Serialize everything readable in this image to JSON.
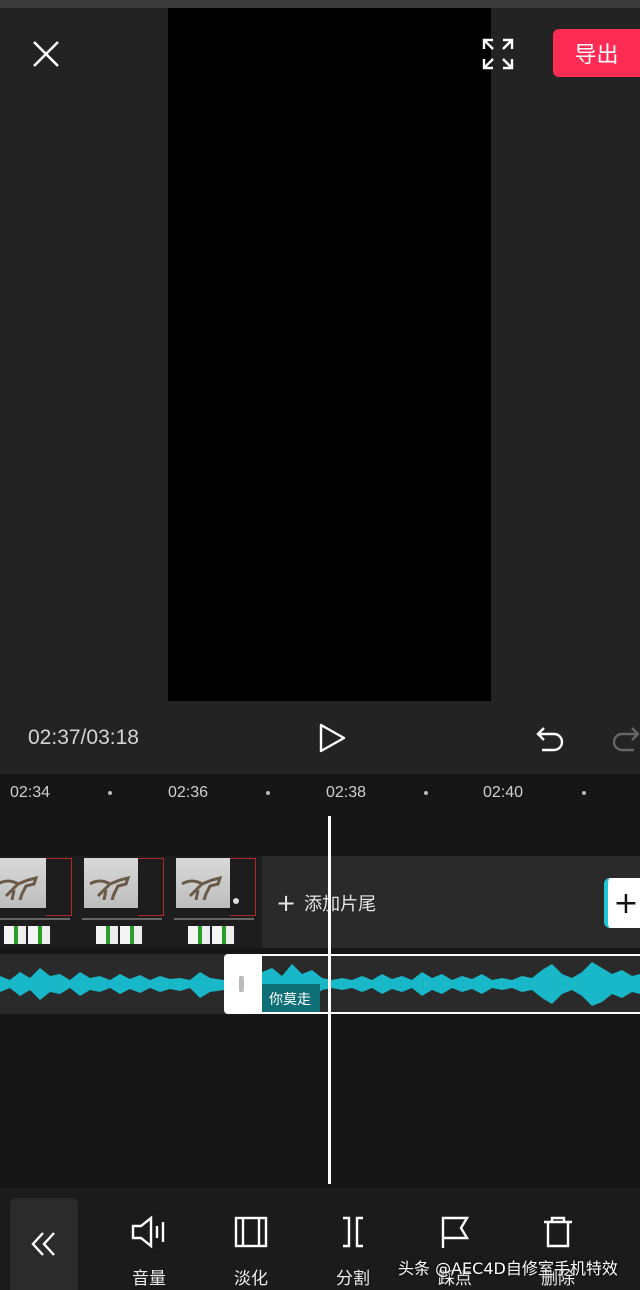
{
  "header": {
    "export_label": "导出",
    "close_icon": "close-icon",
    "fullscreen_icon": "fullscreen-icon"
  },
  "player": {
    "timecode": "02:37/03:18",
    "play_icon": "play-icon",
    "undo_icon": "undo-icon",
    "redo_icon": "redo-icon"
  },
  "timeline": {
    "ruler": [
      "02:34",
      "02:36",
      "02:38",
      "02:40"
    ],
    "add_tail_label": "添加片尾",
    "audio_clip_label": "你莫走"
  },
  "toolbar": {
    "back_icon": "double-chevron-left-icon",
    "items": [
      {
        "label": "音量",
        "icon": "volume-icon"
      },
      {
        "label": "淡化",
        "icon": "fade-icon"
      },
      {
        "label": "分割",
        "icon": "split-icon"
      },
      {
        "label": "踩点",
        "icon": "flag-icon"
      },
      {
        "label": "删除",
        "icon": "trash-icon"
      }
    ]
  },
  "watermark": "头条 @AEC4D自修室手机特效",
  "colors": {
    "accent": "#fe2c55",
    "waveform": "#19b8c9"
  }
}
